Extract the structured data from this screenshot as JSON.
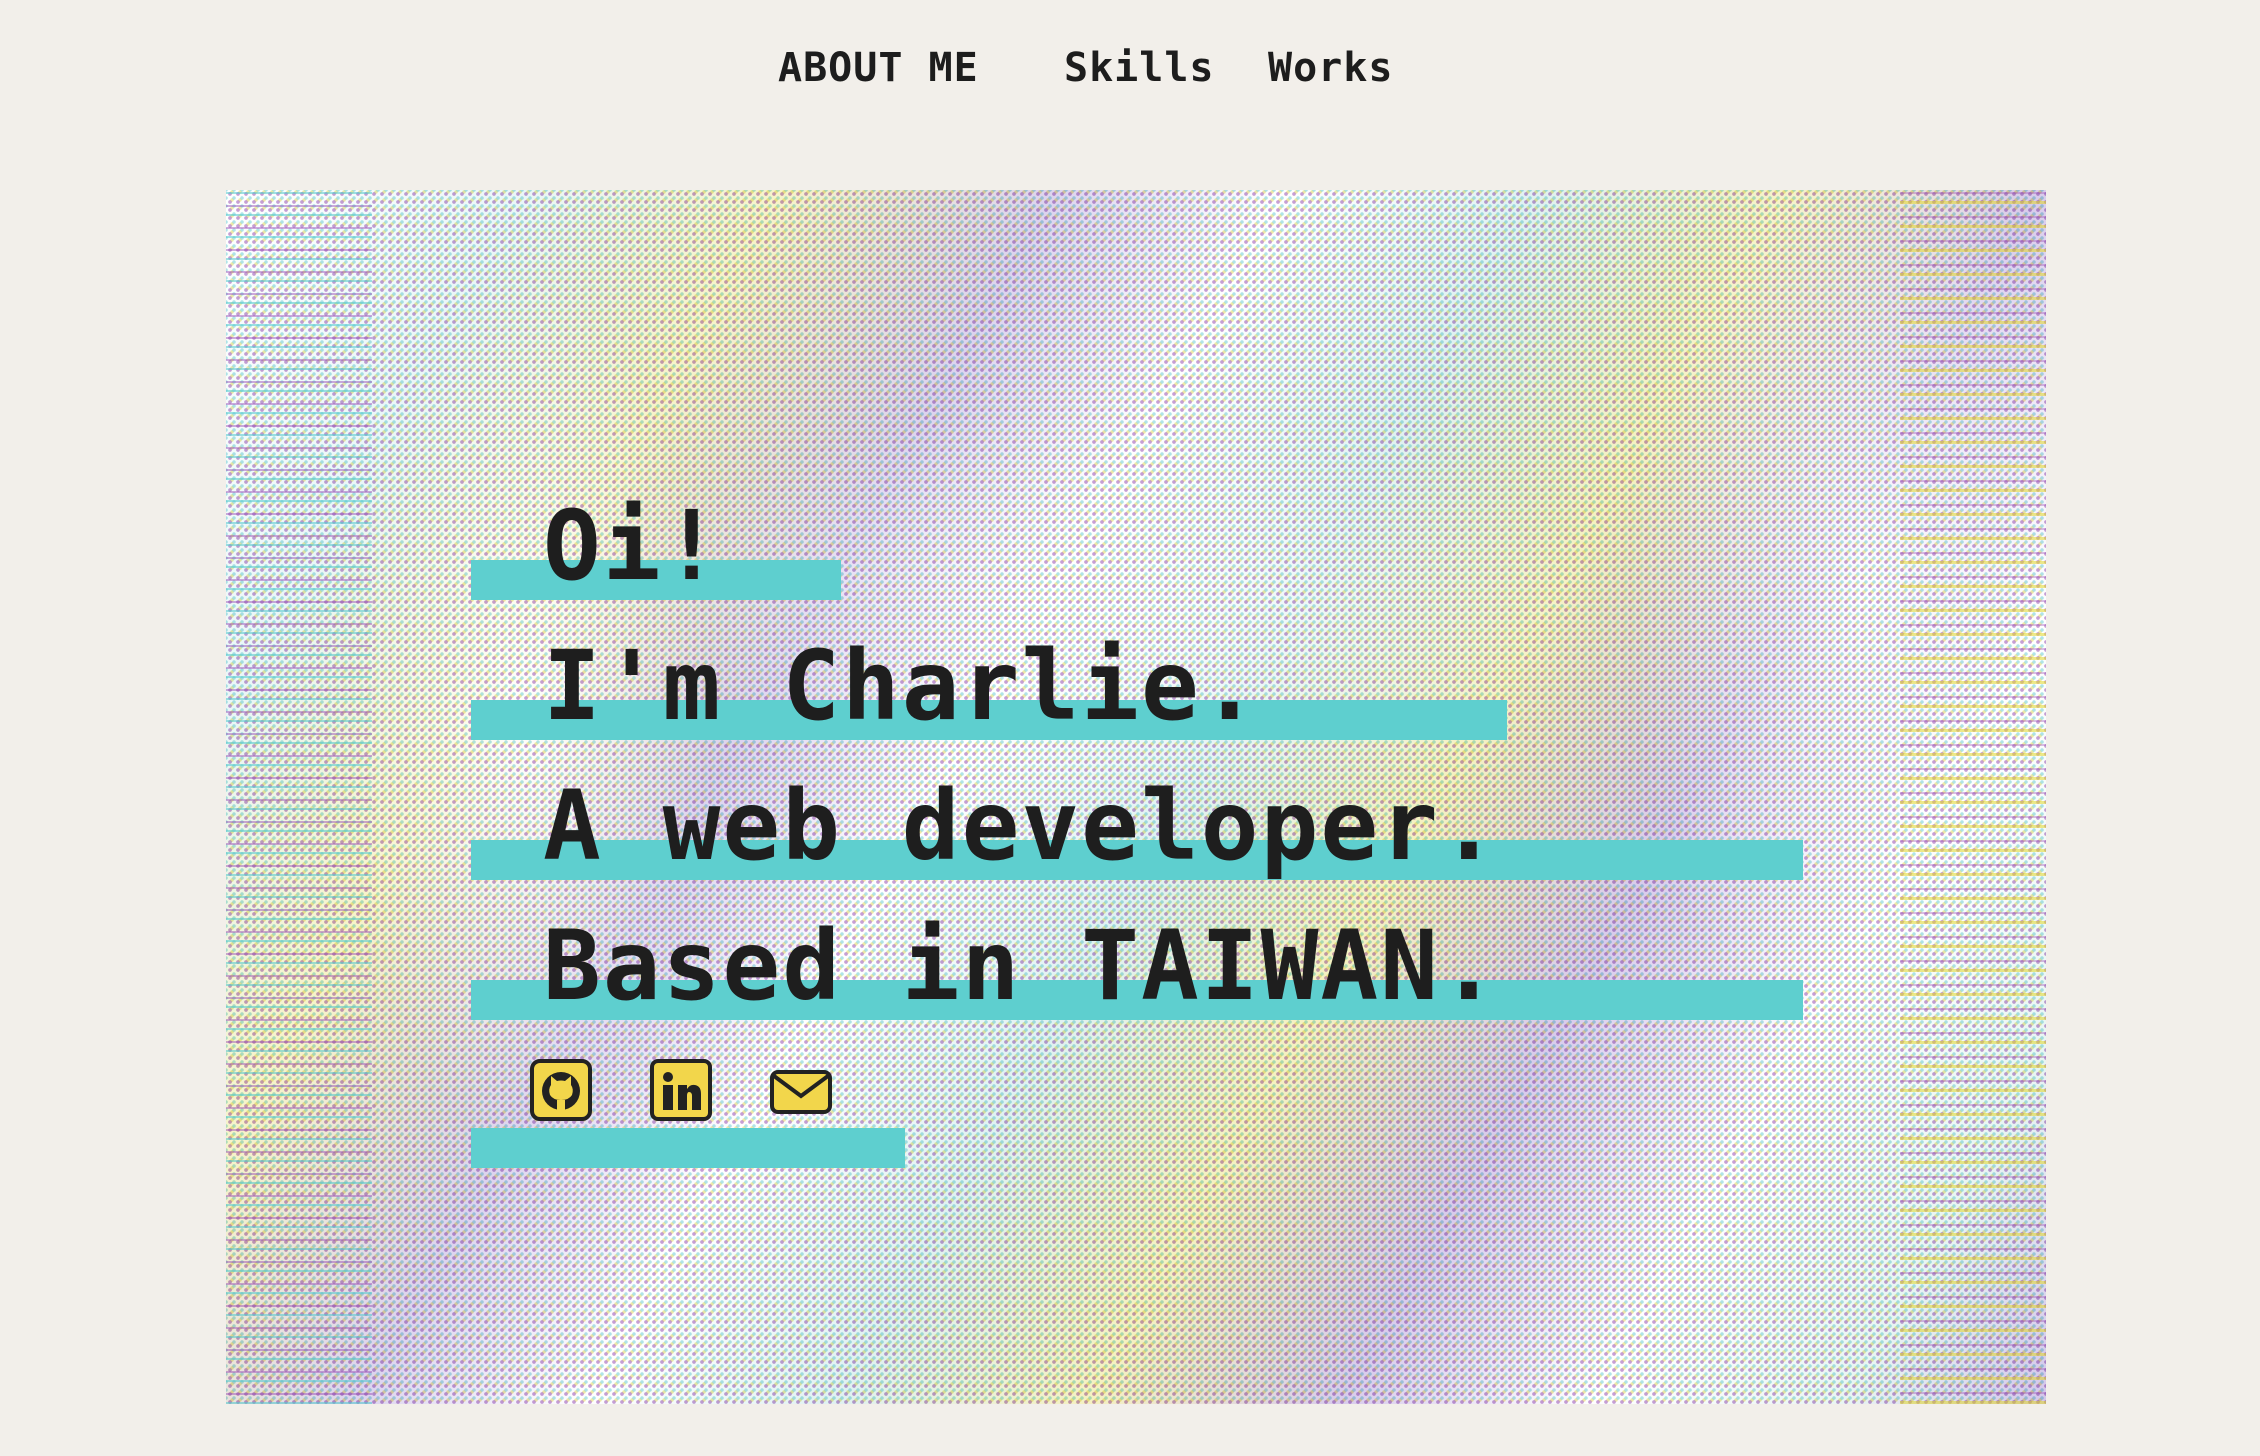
{
  "nav": {
    "about_label": "ABOUT ME",
    "skills_label": "Skills",
    "works_label": "Works"
  },
  "hero": {
    "lines": [
      "Oi!",
      "I'm Charlie.",
      "A web developer.",
      "Based in TAIWAN."
    ],
    "social": [
      {
        "icon": "github-icon"
      },
      {
        "icon": "linkedin-icon"
      },
      {
        "icon": "mail-icon"
      }
    ]
  },
  "colors": {
    "page_background": "#f2efea",
    "highlight_bar": "#5ecfcf",
    "text": "#1e1e1e",
    "icon_fill": "#f2d64b",
    "icon_stroke": "#222222"
  }
}
